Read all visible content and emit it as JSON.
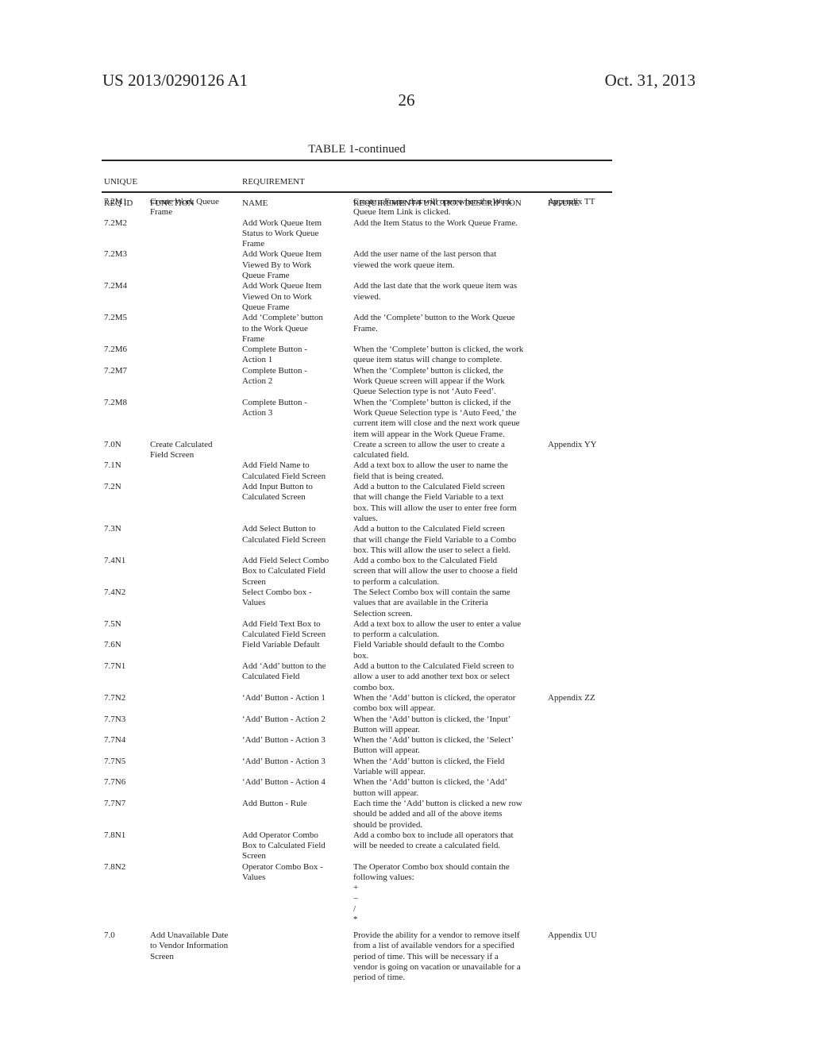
{
  "header": {
    "patent_number": "US 2013/0290126 A1",
    "date": "Oct. 31, 2013",
    "page_number": "26"
  },
  "table": {
    "title": "TABLE 1-continued",
    "columns": [
      {
        "key": "id",
        "lines": [
          "UNIQUE",
          "REQ ID"
        ]
      },
      {
        "key": "function",
        "lines": [
          "",
          "FUNCTION"
        ]
      },
      {
        "key": "name",
        "lines": [
          "REQUIREMENT",
          "NAME"
        ]
      },
      {
        "key": "desc",
        "lines": [
          "",
          "REQUIREMENT/FUNCTION DESCRIPTION"
        ]
      },
      {
        "key": "figure",
        "lines": [
          "",
          "FIGURE"
        ]
      }
    ],
    "rows": [
      {
        "id": "7.2M1",
        "function": [
          "Create Work Queue",
          "Frame"
        ],
        "name": [],
        "desc": [
          "Create a Frame that will open when the Work",
          "Queue Item Link is clicked."
        ],
        "figure": "Appendix TT",
        "lines": 2
      },
      {
        "id": "7.2M2",
        "function": [],
        "name": [
          "Add Work Queue Item",
          "Status to Work Queue",
          "Frame"
        ],
        "desc": [
          "Add the Item Status to the Work Queue Frame."
        ],
        "figure": "",
        "lines": 3
      },
      {
        "id": "7.2M3",
        "function": [],
        "name": [
          "Add Work Queue Item",
          "Viewed By to Work",
          "Queue Frame"
        ],
        "desc": [
          "Add the user name of the last person that",
          "viewed the work queue item."
        ],
        "figure": "",
        "lines": 3
      },
      {
        "id": "7.2M4",
        "function": [],
        "name": [
          "Add Work Queue Item",
          "Viewed On to Work",
          "Queue Frame"
        ],
        "desc": [
          "Add the last date that the work queue item was",
          "viewed."
        ],
        "figure": "",
        "lines": 3
      },
      {
        "id": "7.2M5",
        "function": [],
        "name": [
          "Add ‘Complete’ button",
          "to the Work Queue",
          "Frame"
        ],
        "desc": [
          "Add the ‘Complete’ button to the Work Queue",
          "Frame."
        ],
        "figure": "",
        "lines": 3
      },
      {
        "id": "7.2M6",
        "function": [],
        "name": [
          "Complete Button -",
          "Action 1"
        ],
        "desc": [
          "When the ‘Complete’ button is clicked, the work",
          "queue item status will change to complete."
        ],
        "figure": "",
        "lines": 2
      },
      {
        "id": "7.2M7",
        "function": [],
        "name": [
          "Complete Button -",
          "Action 2"
        ],
        "desc": [
          "When the ‘Complete’ button is clicked, the",
          "Work Queue screen will appear if the Work",
          "Queue Selection type is not ‘Auto Feed’."
        ],
        "figure": "",
        "lines": 3
      },
      {
        "id": "7.2M8",
        "function": [],
        "name": [
          "Complete Button -",
          "Action 3"
        ],
        "desc": [
          "When the ‘Complete’ button is clicked, if the",
          "Work Queue Selection type is ‘Auto Feed,’ the",
          "current item will close and the next work queue",
          "item will appear in the Work Queue Frame."
        ],
        "figure": "",
        "lines": 4
      },
      {
        "id": "7.0N",
        "function": [
          "Create Calculated",
          "Field Screen"
        ],
        "name": [],
        "desc": [
          "Create a screen to allow the user to create a",
          "calculated field."
        ],
        "figure": "Appendix YY",
        "lines": 2
      },
      {
        "id": "7.1N",
        "function": [],
        "name": [
          "Add Field Name to",
          "Calculated Field Screen"
        ],
        "desc": [
          "Add a text box to allow the user to name the",
          "field that is being created."
        ],
        "figure": "",
        "lines": 2
      },
      {
        "id": "7.2N",
        "function": [],
        "name": [
          "Add Input Button to",
          "Calculated Screen"
        ],
        "desc": [
          "Add a button to the Calculated Field screen",
          "that will change the Field Variable to a text",
          "box. This will allow the user to enter free form",
          "values."
        ],
        "figure": "",
        "lines": 4
      },
      {
        "id": "7.3N",
        "function": [],
        "name": [
          "Add Select Button to",
          "Calculated Field Screen"
        ],
        "desc": [
          "Add a button to the Calculated Field screen",
          "that will change the Field Variable to a Combo",
          "box. This will allow the user to select a field."
        ],
        "figure": "",
        "lines": 3
      },
      {
        "id": "7.4N1",
        "function": [],
        "name": [
          "Add Field Select Combo",
          "Box to Calculated Field",
          "Screen"
        ],
        "desc": [
          "Add a combo box to the Calculated Field",
          "screen that will allow the user to choose a field",
          "to perform a calculation."
        ],
        "figure": "",
        "lines": 3
      },
      {
        "id": "7.4N2",
        "function": [],
        "name": [
          "Select Combo box -",
          "Values"
        ],
        "desc": [
          "The Select Combo box will contain the same",
          "values that are available in the Criteria",
          "Selection screen."
        ],
        "figure": "",
        "lines": 3
      },
      {
        "id": "7.5N",
        "function": [],
        "name": [
          "Add Field Text Box to",
          "Calculated Field Screen"
        ],
        "desc": [
          "Add a text box to allow the user to enter a value",
          "to perform a calculation."
        ],
        "figure": "",
        "lines": 2
      },
      {
        "id": "7.6N",
        "function": [],
        "name": [
          "Field Variable Default"
        ],
        "desc": [
          "Field Variable should default to the Combo",
          "box."
        ],
        "figure": "",
        "lines": 2
      },
      {
        "id": "7.7N1",
        "function": [],
        "name": [
          "Add ‘Add’ button to the",
          "Calculated Field"
        ],
        "desc": [
          "Add a button to the Calculated Field screen to",
          "allow a user to add another text box or select",
          "combo box."
        ],
        "figure": "",
        "lines": 3
      },
      {
        "id": "7.7N2",
        "function": [],
        "name": [
          "‘Add’ Button - Action 1"
        ],
        "desc": [
          "When the ‘Add’ button is clicked, the operator",
          "combo box will appear."
        ],
        "figure": "Appendix ZZ",
        "lines": 2
      },
      {
        "id": "7.7N3",
        "function": [],
        "name": [
          "‘Add’ Button - Action 2"
        ],
        "desc": [
          "When the ‘Add’ button is clicked, the ‘Input’",
          "Button will appear."
        ],
        "figure": "",
        "lines": 2
      },
      {
        "id": "7.7N4",
        "function": [],
        "name": [
          "‘Add’ Button - Action 3"
        ],
        "desc": [
          "When the ‘Add’ button is clicked, the ‘Select’",
          "Button will appear."
        ],
        "figure": "",
        "lines": 2
      },
      {
        "id": "7.7N5",
        "function": [],
        "name": [
          "‘Add’ Button - Action 3"
        ],
        "desc": [
          "When the ‘Add’ button is clicked, the Field",
          "Variable will appear."
        ],
        "figure": "",
        "lines": 2
      },
      {
        "id": "7.7N6",
        "function": [],
        "name": [
          "‘Add’ Button - Action 4"
        ],
        "desc": [
          "When the ‘Add’ button is clicked, the ‘Add’",
          "button will appear."
        ],
        "figure": "",
        "lines": 2
      },
      {
        "id": "7.7N7",
        "function": [],
        "name": [
          "Add Button - Rule"
        ],
        "desc": [
          "Each time the ‘Add’ button is clicked a new row",
          "should be added and all of the above items",
          "should be provided."
        ],
        "figure": "",
        "lines": 3
      },
      {
        "id": "7.8N1",
        "function": [],
        "name": [
          "Add Operator Combo",
          "Box to Calculated Field",
          "Screen"
        ],
        "desc": [
          "Add a combo box to include all operators that",
          "will be needed to create a calculated field."
        ],
        "figure": "",
        "lines": 3
      },
      {
        "id": "7.8N2",
        "function": [],
        "name": [
          "Operator Combo Box -",
          "Values"
        ],
        "desc": [
          "The Operator Combo box should contain the",
          "following values:",
          "+",
          "−",
          "/",
          "*"
        ],
        "figure": "",
        "lines": 6.5
      },
      {
        "id": "7.0",
        "function": [
          "Add Unavailable Date",
          "to Vendor Information",
          "Screen"
        ],
        "name": [],
        "desc": [
          "Provide the ability for a vendor to remove itself",
          "from a list of available vendors for a specified",
          "period of time. This will be necessary if a",
          "vendor is going on vacation or unavailable for a",
          "period of time."
        ],
        "figure": "Appendix UU",
        "lines": 5
      }
    ]
  }
}
